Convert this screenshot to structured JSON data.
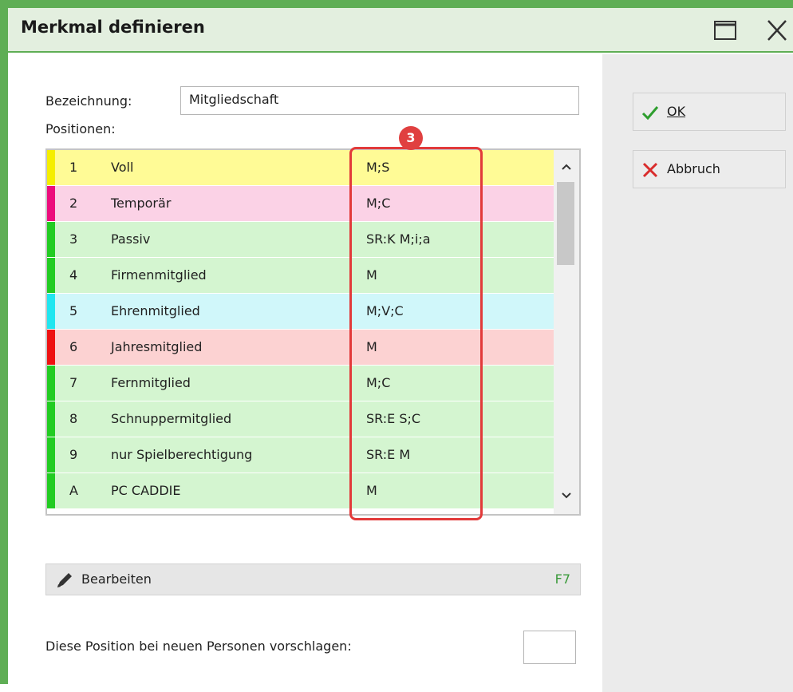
{
  "window": {
    "title": "Merkmal definieren",
    "maximize_icon": "maximize-icon",
    "close_icon": "close-icon"
  },
  "form": {
    "name_label": "Bezeichnung:",
    "name_value": "Mitgliedschaft",
    "positions_label": "Positionen:"
  },
  "positions": [
    {
      "num": "1",
      "name": "Voll",
      "code": "M;S",
      "color": "#f5ee00",
      "bg": "#fffb96"
    },
    {
      "num": "2",
      "name": "Temporär",
      "code": "M;C",
      "color": "#ec0c7c",
      "bg": "#fbd2e6"
    },
    {
      "num": "3",
      "name": "Passiv",
      "code": "SR:K M;i;a",
      "color": "#22cc22",
      "bg": "#d4f5d0"
    },
    {
      "num": "4",
      "name": "Firmenmitglied",
      "code": "M",
      "color": "#22cc22",
      "bg": "#d4f5d0"
    },
    {
      "num": "5",
      "name": "Ehrenmitglied",
      "code": "M;V;C",
      "color": "#20e6f0",
      "bg": "#d0f7fa"
    },
    {
      "num": "6",
      "name": "Jahresmitglied",
      "code": "M",
      "color": "#ee1111",
      "bg": "#fcd2d2"
    },
    {
      "num": "7",
      "name": "Fernmitglied",
      "code": "M;C",
      "color": "#22cc22",
      "bg": "#d4f5d0"
    },
    {
      "num": "8",
      "name": "Schnuppermitglied",
      "code": "SR:E S;C",
      "color": "#22cc22",
      "bg": "#d4f5d0"
    },
    {
      "num": "9",
      "name": "nur Spielberechtigung",
      "code": "SR:E M",
      "color": "#22cc22",
      "bg": "#d4f5d0"
    },
    {
      "num": "A",
      "name": "PC CADDIE",
      "code": "M",
      "color": "#22cc22",
      "bg": "#d4f5d0"
    }
  ],
  "annotation": {
    "number": "3",
    "color": "#e23a3a"
  },
  "edit": {
    "label": "Bearbeiten",
    "shortcut": "F7",
    "icon": "pencil-icon"
  },
  "suggest": {
    "label": "Diese Position bei neuen Personen vorschlagen:",
    "value": ""
  },
  "buttons": {
    "ok": {
      "label": "OK",
      "icon": "checkmark-icon",
      "color": "#2e9e2e"
    },
    "cancel": {
      "label": "Abbruch",
      "icon": "x-icon",
      "color": "#d92c2c"
    }
  }
}
